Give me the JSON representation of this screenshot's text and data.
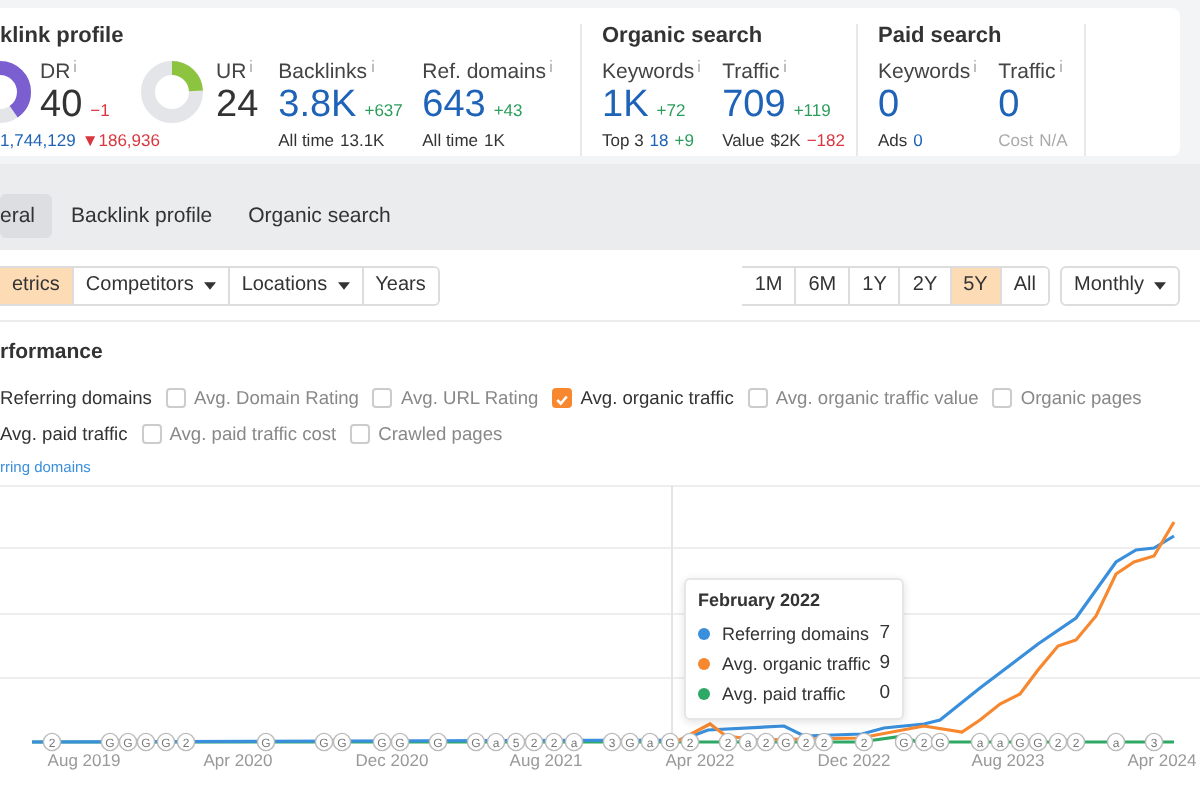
{
  "overview": [
    {
      "title": "klink profile",
      "metrics": [
        {
          "kind": "rating",
          "label": "DR",
          "value": "40",
          "delta": {
            "text": "−1",
            "kind": "down"
          },
          "sub": [
            {
              "text": "1,744,129",
              "kind": "number"
            },
            {
              "text": "▼186,936",
              "kind": "down"
            }
          ]
        },
        {
          "kind": "rating",
          "label": "UR",
          "value": "24",
          "level": 0.24
        },
        {
          "kind": "count",
          "label": "Backlinks",
          "value": "3.8K",
          "delta": {
            "text": "+637",
            "kind": "up"
          },
          "sub": [
            {
              "text": "All time",
              "kind": "label"
            },
            {
              "text": "13.1K",
              "kind": "label"
            }
          ]
        },
        {
          "kind": "count",
          "label": "Ref. domains",
          "value": "643",
          "delta": {
            "text": "+43",
            "kind": "up"
          },
          "sub": [
            {
              "text": "All time",
              "kind": "label"
            },
            {
              "text": "1K",
              "kind": "label"
            }
          ]
        }
      ]
    },
    {
      "title": "Organic search",
      "metrics": [
        {
          "kind": "count",
          "label": "Keywords",
          "value": "1K",
          "delta": {
            "text": "+72",
            "kind": "up"
          },
          "sub": [
            {
              "text": "Top 3",
              "kind": "label"
            },
            {
              "text": "18",
              "kind": "number"
            },
            {
              "text": "+9",
              "kind": "up"
            }
          ]
        },
        {
          "kind": "count",
          "label": "Traffic",
          "value": "709",
          "delta": {
            "text": "+119",
            "kind": "up"
          },
          "sub": [
            {
              "text": "Value",
              "kind": "label"
            },
            {
              "text": "$2K",
              "kind": "label"
            },
            {
              "text": "−182",
              "kind": "down"
            }
          ]
        }
      ]
    },
    {
      "title": "Paid search",
      "metrics": [
        {
          "kind": "count",
          "label": "Keywords",
          "value": "0",
          "sub": [
            {
              "text": "Ads",
              "kind": "label"
            },
            {
              "text": "0",
              "kind": "number"
            }
          ]
        },
        {
          "kind": "count",
          "label": "Traffic",
          "value": "0",
          "sub": [
            {
              "text": "Cost",
              "kind": "na"
            },
            {
              "text": "N/A",
              "kind": "na"
            }
          ]
        }
      ]
    }
  ],
  "tabs": [
    {
      "label": "eral",
      "selected": true
    },
    {
      "label": "Backlink profile",
      "selected": false
    },
    {
      "label": "Organic search",
      "selected": false
    }
  ],
  "filters": [
    {
      "label": "etrics",
      "selected": true,
      "dropdown": false
    },
    {
      "label": "Competitors",
      "selected": false,
      "dropdown": true
    },
    {
      "label": "Locations",
      "selected": false,
      "dropdown": true
    },
    {
      "label": "Years",
      "selected": false,
      "dropdown": false
    }
  ],
  "ranges": [
    {
      "label": "1M",
      "selected": false
    },
    {
      "label": "6M",
      "selected": false
    },
    {
      "label": "1Y",
      "selected": false
    },
    {
      "label": "2Y",
      "selected": false
    },
    {
      "label": "5Y",
      "selected": true
    },
    {
      "label": "All",
      "selected": false
    }
  ],
  "interval": {
    "label": "Monthly"
  },
  "section_title": "rformance",
  "metric_rows": [
    [
      {
        "label": "Referring domains",
        "checked": true
      },
      {
        "label": "Avg. Domain Rating",
        "checked": false
      },
      {
        "label": "Avg. URL Rating",
        "checked": false
      },
      {
        "label": "Avg. organic traffic",
        "checked": true
      },
      {
        "label": "Avg. organic traffic value",
        "checked": false
      },
      {
        "label": "Organic pages",
        "checked": false
      }
    ],
    [
      {
        "label": "Avg. paid traffic",
        "checked": true
      },
      {
        "label": "Avg. paid traffic cost",
        "checked": false
      },
      {
        "label": "Crawled pages",
        "checked": false
      }
    ]
  ],
  "chart": {
    "axis_title": "rring domains",
    "x_labels": [
      "Aug 2019",
      "Apr 2020",
      "Dec 2020",
      "Aug 2021",
      "Apr 2022",
      "Dec 2022",
      "Aug 2023",
      "Apr 2024"
    ],
    "markers": [
      "2",
      "G",
      "G",
      "G",
      "G",
      "2",
      "G",
      "G",
      "G",
      "G",
      "G",
      "G",
      "G",
      "a",
      "5",
      "2",
      "2",
      "a",
      "3",
      "G",
      "a",
      "G",
      "2",
      "2",
      "a",
      "2",
      "G",
      "2",
      "2",
      "2",
      "G",
      "2",
      "G",
      "a",
      "a",
      "G",
      "G",
      "2",
      "2",
      "a",
      "3"
    ],
    "tooltip": {
      "title": "February 2022",
      "rows": [
        {
          "label": "Referring domains",
          "value": "7",
          "color": "#3a8fdc"
        },
        {
          "label": "Avg. organic traffic",
          "value": "9",
          "color": "#f7882f"
        },
        {
          "label": "Avg. paid traffic",
          "value": "0",
          "color": "#2ea865"
        }
      ]
    }
  }
}
